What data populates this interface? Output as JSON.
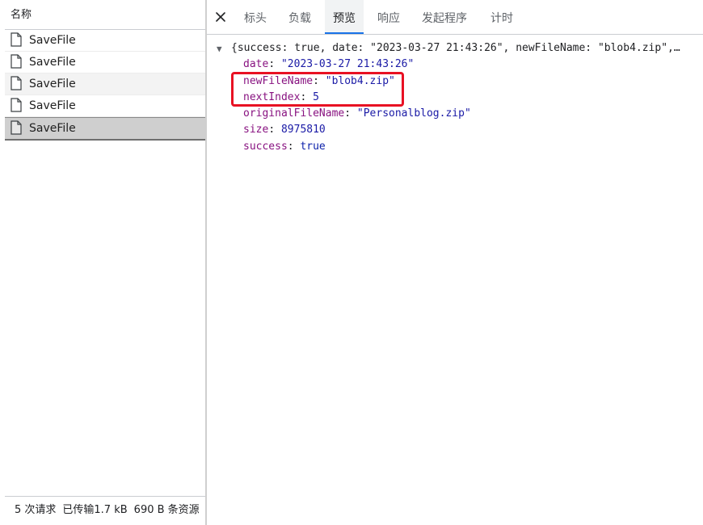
{
  "request_list": {
    "header": "名称",
    "items": [
      {
        "label": "SaveFile"
      },
      {
        "label": "SaveFile"
      },
      {
        "label": "SaveFile"
      },
      {
        "label": "SaveFile"
      },
      {
        "label": "SaveFile"
      }
    ],
    "selected_index": 4,
    "status": {
      "requests": "5 次请求",
      "transferred": "已传输1.7 kB",
      "resources": "690 B 条资源"
    }
  },
  "tabs": {
    "close_label": "×",
    "items": [
      "标头",
      "负载",
      "预览",
      "响应",
      "发起程序",
      "计时"
    ],
    "active": "预览"
  },
  "preview": {
    "summary": "{success: true, date: \"2023-03-27 21:43:26\", newFileName: \"blob4.zip\",…",
    "props": [
      {
        "key": "date",
        "value": "\"2023-03-27 21:43:26\"",
        "kind": "str"
      },
      {
        "key": "newFileName",
        "value": "\"blob4.zip\"",
        "kind": "str"
      },
      {
        "key": "nextIndex",
        "value": "5",
        "kind": "num"
      },
      {
        "key": "originalFileName",
        "value": "\"Personalblog.zip\"",
        "kind": "str"
      },
      {
        "key": "size",
        "value": "8975810",
        "kind": "num"
      },
      {
        "key": "success",
        "value": "true",
        "kind": "bool"
      }
    ]
  },
  "colors": {
    "accent": "#1a73e8",
    "highlight": "#e81123",
    "json_key": "#881280",
    "json_string": "#1a1aa6"
  }
}
